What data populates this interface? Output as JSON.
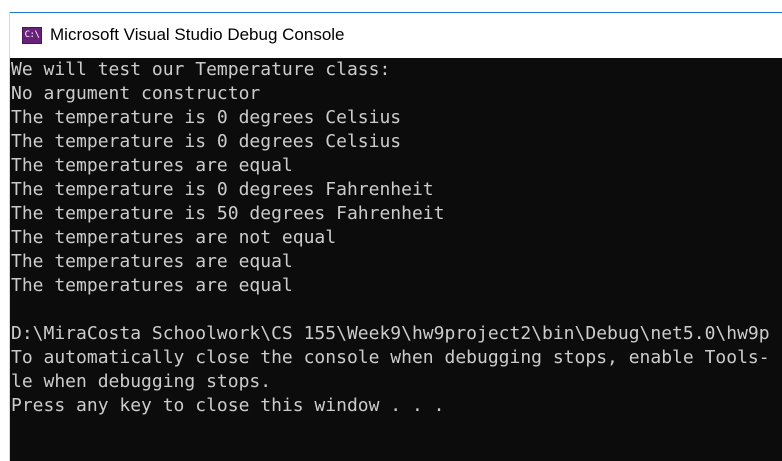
{
  "window": {
    "title": "Microsoft Visual Studio Debug Console",
    "icon": "console-app-icon",
    "icon_glyph": "C:\\"
  },
  "console": {
    "lines": [
      "We will test our Temperature class:",
      "No argument constructor",
      "The temperature is 0 degrees Celsius",
      "The temperature is 0 degrees Celsius",
      "The temperatures are equal",
      "The temperature is 0 degrees Fahrenheit",
      "The temperature is 50 degrees Fahrenheit",
      "The temperatures are not equal",
      "The temperatures are equal",
      "The temperatures are equal",
      "",
      "D:\\MiraCosta Schoolwork\\CS 155\\Week9\\hw9project2\\bin\\Debug\\net5.0\\hw9p",
      "To automatically close the console when debugging stops, enable Tools-",
      "le when debugging stops.",
      "Press any key to close this window . . ."
    ]
  },
  "colors": {
    "console_background": "#0c0c0c",
    "console_text": "#cccccc",
    "titlebar_background": "#ffffff",
    "icon_background": "#68217a"
  }
}
